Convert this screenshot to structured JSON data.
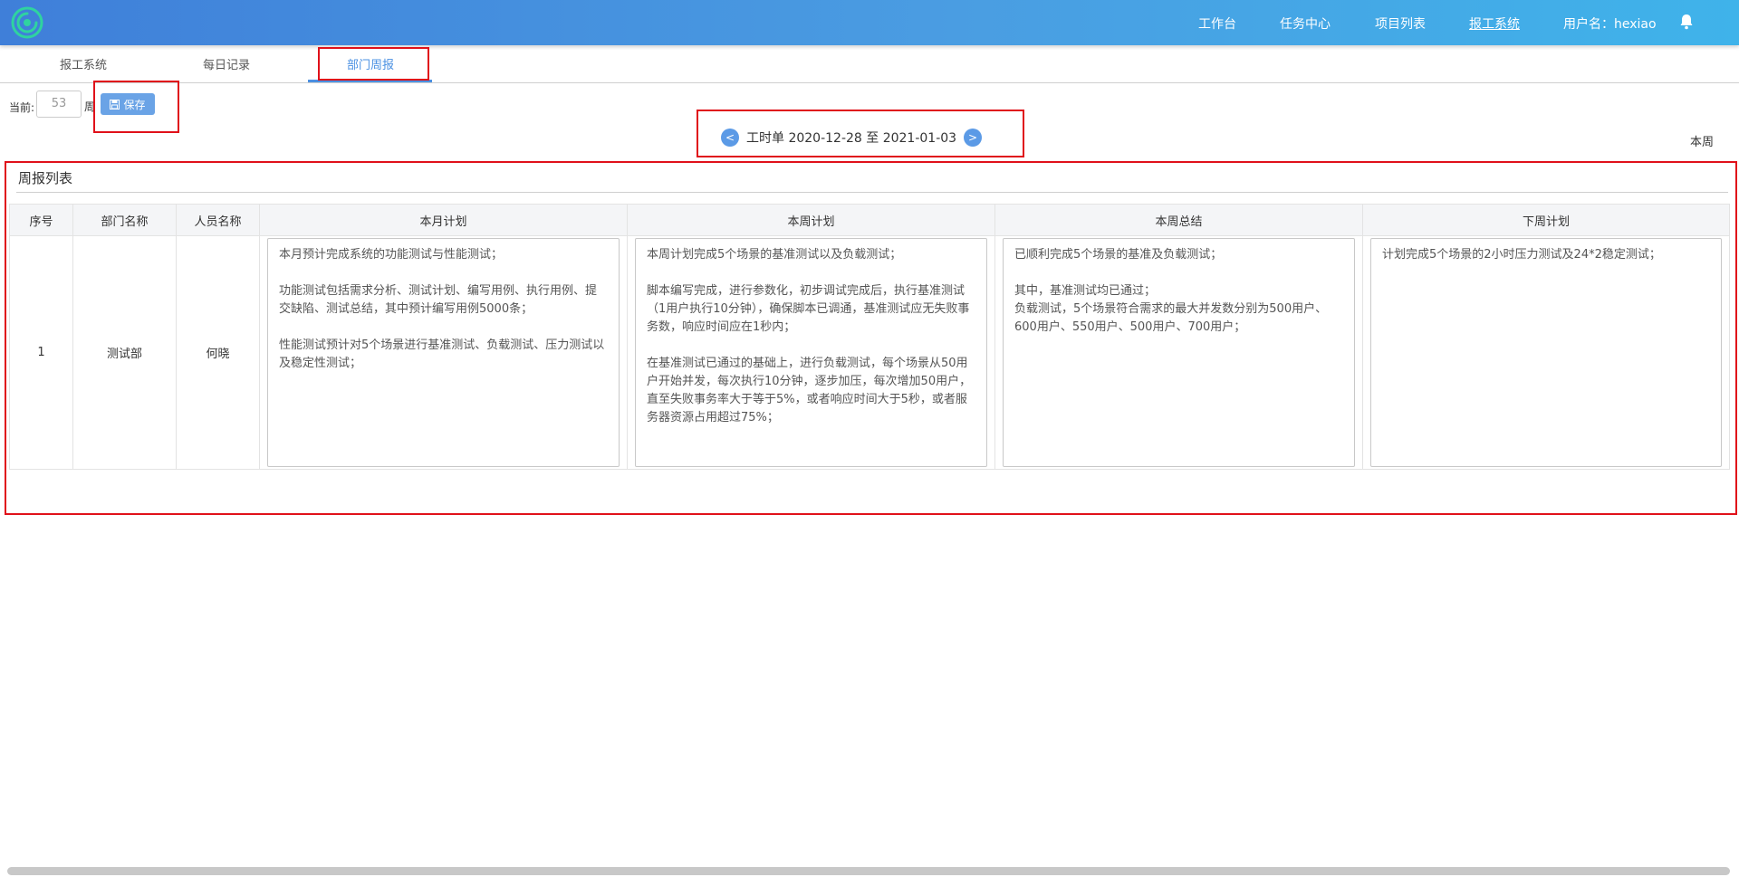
{
  "nav": {
    "items": [
      "工作台",
      "任务中心",
      "项目列表",
      "报工系统"
    ],
    "active": "报工系统",
    "user": "用户名：hexiao"
  },
  "subtabs": [
    "报工系统",
    "每日记录",
    "部门周报"
  ],
  "toolbar": {
    "current_label": "当前:",
    "week_value": "53",
    "week_suffix": "周",
    "save_label": "保存"
  },
  "week_nav": {
    "prev": "<",
    "label": "工时单 2020-12-28 至 2021-01-03",
    "next": ">",
    "this_week": "本周"
  },
  "panel": {
    "title": "周报列表",
    "columns": [
      "序号",
      "部门名称",
      "人员名称",
      "本月计划",
      "本周计划",
      "本周总结",
      "下周计划"
    ],
    "rows": [
      {
        "index": "1",
        "department": "测试部",
        "person": "何晓",
        "month_plan": "本月预计完成系统的功能测试与性能测试；\n\n功能测试包括需求分析、测试计划、编写用例、执行用例、提交缺陷、测试总结，其中预计编写用例5000条；\n\n性能测试预计对5个场景进行基准测试、负载测试、压力测试以及稳定性测试；",
        "week_plan": "本周计划完成5个场景的基准测试以及负载测试；\n\n脚本编写完成，进行参数化，初步调试完成后，执行基准测试（1用户执行10分钟），确保脚本已调通，基准测试应无失败事务数，响应时间应在1秒内；\n\n在基准测试已通过的基础上，进行负载测试，每个场景从50用户开始并发，每次执行10分钟，逐步加压，每次增加50用户，直至失败事务率大于等于5%，或者响应时间大于5秒，或者服务器资源占用超过75%；",
        "week_summary": "已顺利完成5个场景的基准及负载测试；\n\n其中，基准测试均已通过；\n负载测试，5个场景符合需求的最大并发数分别为500用户、600用户、550用户、500用户、700用户；",
        "next_week_plan": "计划完成5个场景的2小时压力测试及24*2稳定测试；"
      }
    ]
  },
  "colors": {
    "accent": "#4a90e2",
    "annotation": "#e0111a"
  }
}
